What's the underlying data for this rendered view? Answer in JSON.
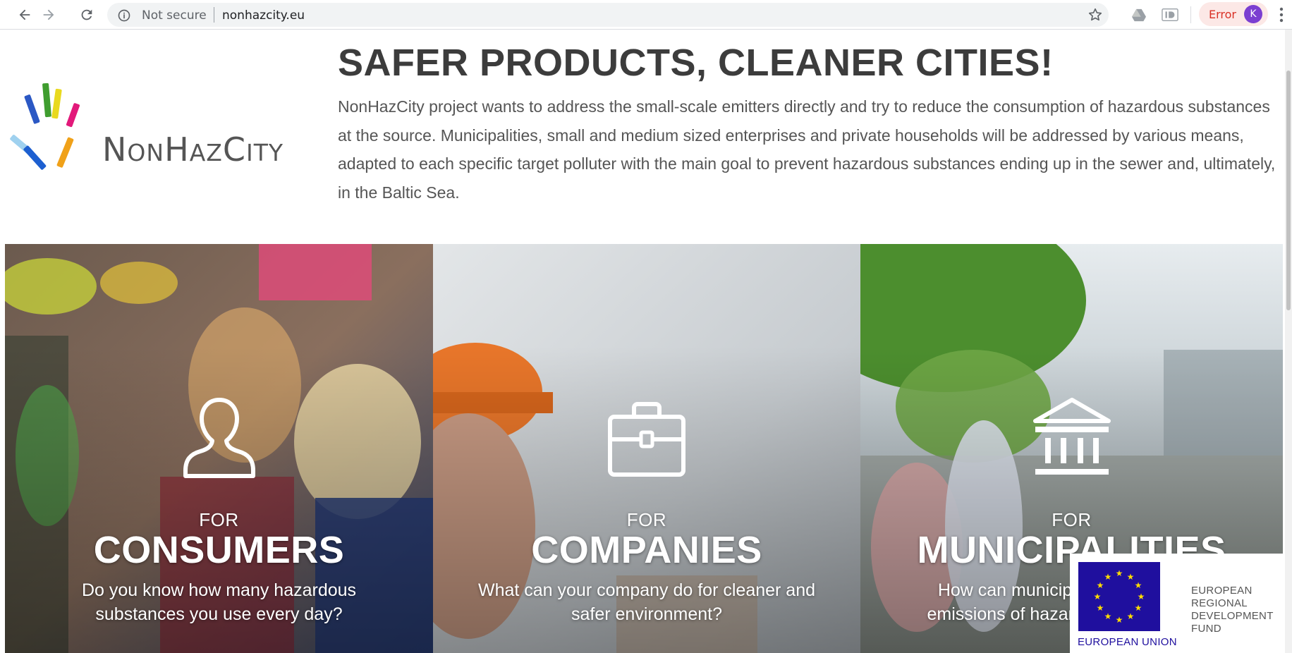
{
  "browser": {
    "security_label": "Not secure",
    "url": "nonhazcity.eu",
    "profile_status": "Error",
    "profile_initial": "K",
    "icons": [
      "back-icon",
      "forward-icon",
      "reload-icon",
      "info-icon",
      "star-icon",
      "drive-extension-icon",
      "id-extension-icon",
      "more-icon"
    ]
  },
  "header": {
    "logo_text": {
      "n": "N",
      "on": "ON",
      "h": "H",
      "az": "AZ",
      "c": "C",
      "ity": "ITY"
    },
    "headline": "SAFER PRODUCTS, CLEANER CITIES!",
    "intro": "NonHazCity project wants to address the small-scale emitters directly and try to reduce the consumption of hazardous substances at the source. Municipalities, small and medium sized enterprises and private households will be addressed by various means, adapted to each specific target polluter with the main goal to prevent hazardous substances ending up in the sewer and, ultimately, in the Baltic Sea."
  },
  "panels": [
    {
      "for": "FOR",
      "title": "CONSUMERS",
      "description": "Do you know how many hazardous substances you use every day?",
      "icon": "person-icon"
    },
    {
      "for": "FOR",
      "title": "COMPANIES",
      "description": "What can your company do for cleaner and safer environment?",
      "icon": "briefcase-icon"
    },
    {
      "for": "FOR",
      "title": "MUNICIPALITIES",
      "description": "How can municipalities reduce the emissions of hazardous substances?",
      "icon": "government-building-icon"
    }
  ],
  "eu_badge": {
    "union_label": "EUROPEAN UNION",
    "fund_label": "EUROPEAN REGIONAL DEVELOPMENT FUND"
  },
  "colors": {
    "eu_blue": "#1f0f9e",
    "eu_gold": "#ffdd00",
    "error_chip": "#fce8e6",
    "avatar": "#7b3fd1",
    "text_gray": "#555555"
  }
}
